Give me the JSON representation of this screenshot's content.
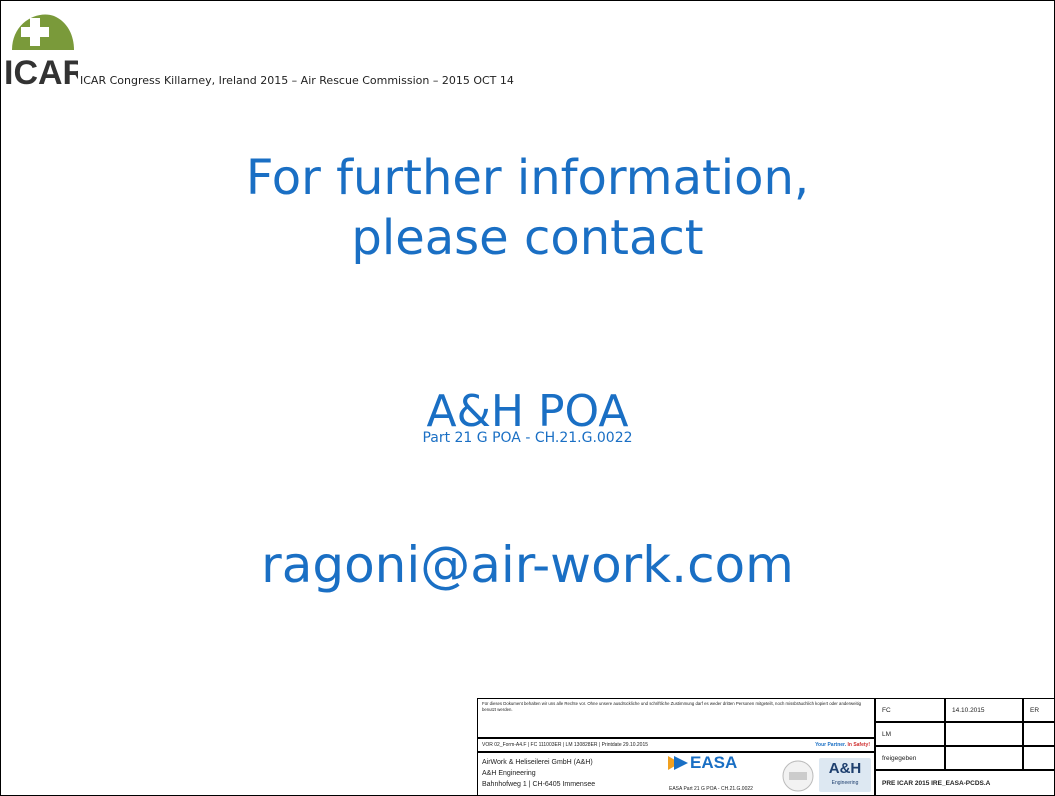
{
  "header": {
    "logo_text": "ICAR",
    "text": "ICAR Congress Killarney, Ireland 2015 – Air Rescue Commission – 2015 OCT 14"
  },
  "main": {
    "title_line1": "For further information,",
    "title_line2": "please contact",
    "company": "A&H POA",
    "company_sub": "Part 21 G POA - CH.21.G.0022",
    "email": "ragoni@air-work.com"
  },
  "title_block": {
    "notice": "Für dieses Dokument behalten wir uns alle Rechte vor. Ohne unsere ausdrückliche und schriftliche Zustimmung darf es weder dritten Personen mitgeteilt, noch missbräuchlich kopiert oder anderweitig benutzt werden.",
    "form_line": "VOR 02_Form-A4.F | FC 111003ER | LM 130828ER | Printdate 29.10.2015",
    "slogan_prefix": "Your Partner.",
    "slogan_suffix": "In Safety!",
    "address_line1": "AirWork & Heliseilerei GmbH (A&H)",
    "address_line2": "A&H Engineering",
    "address_line3": "Bahnhofweg 1 | CH-6405 Immensee",
    "easa_logo": "EASA",
    "easa_ref": "EASA Part 21 G POA - CH.21.G.0022",
    "ah_logo": "A&H",
    "ah_logo_sub": "Engineering",
    "fc_label": "FC",
    "fc_date": "14.10.2015",
    "fc_initials": "ER",
    "lm_label": "LM",
    "freigegeben": "freigegeben",
    "doc_id": "PRE ICAR 2015  IRE_EASA-PCDS.A"
  },
  "colors": {
    "accent": "#1a6fc4",
    "logo_green": "#7a9a3a"
  }
}
